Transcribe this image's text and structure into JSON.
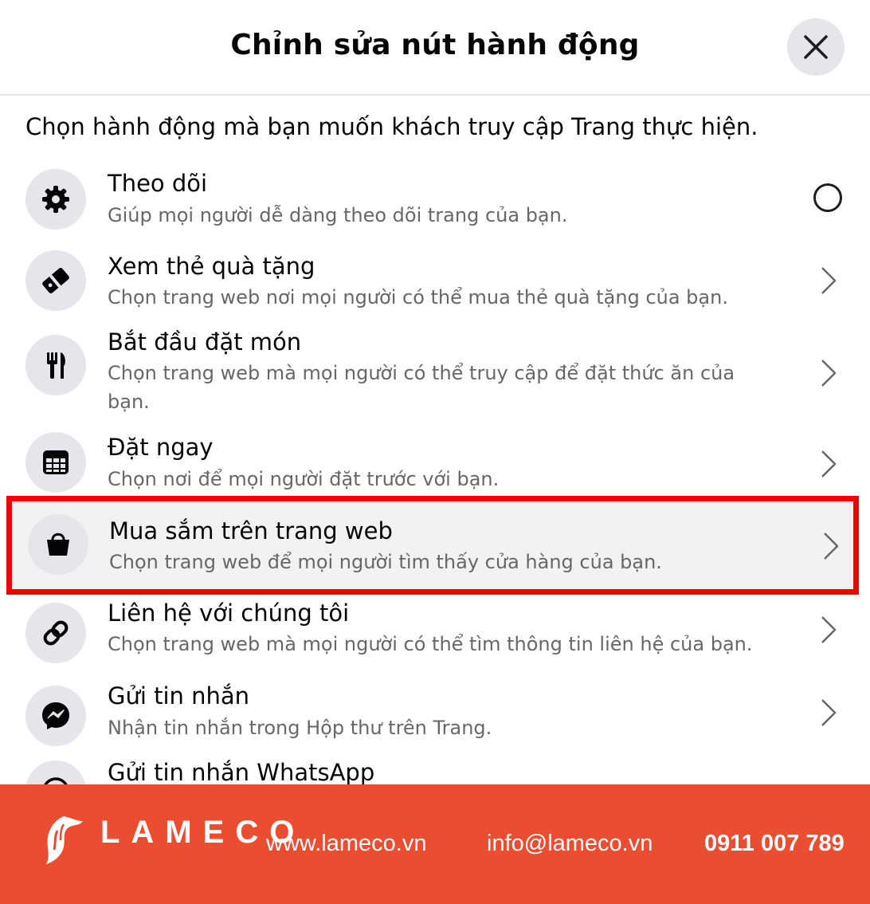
{
  "dialog": {
    "title": "Chỉnh sửa nút hành động",
    "close_icon": "close-icon",
    "intro": "Chọn hành động mà bạn muốn khách truy cập Trang thực hiện."
  },
  "actions": [
    {
      "title": "Theo dõi",
      "description": "Giúp mọi người dễ dàng theo dõi trang của bạn.",
      "icon": "gear-icon",
      "control": "radio-unselected"
    },
    {
      "title": "Xem thẻ quà tặng",
      "description": "Chọn trang web nơi mọi người có thể mua thẻ quà tặng của bạn.",
      "icon": "gift-card-icon",
      "control": "chevron-right"
    },
    {
      "title": "Bắt đầu đặt món",
      "description": "Chọn trang web mà mọi người có thể truy cập để đặt thức ăn của bạn.",
      "icon": "fork-knife-icon",
      "control": "chevron-right"
    },
    {
      "title": "Đặt ngay",
      "description": "Chọn nơi để mọi người đặt trước với bạn.",
      "icon": "calendar-icon",
      "control": "chevron-right"
    },
    {
      "title": "Mua sắm trên trang web",
      "description": "Chọn trang web để mọi người tìm thấy cửa hàng của bạn.",
      "icon": "shopping-bag-icon",
      "control": "chevron-right",
      "highlighted": true
    },
    {
      "title": "Liên hệ với chúng tôi",
      "description": "Chọn trang web mà mọi người có thể tìm thông tin liên hệ của bạn.",
      "icon": "link-icon",
      "control": "chevron-right"
    },
    {
      "title": "Gửi tin nhắn",
      "description": "Nhận tin nhắn trong Hộp thư trên Trang.",
      "icon": "messenger-icon",
      "control": "chevron-right"
    },
    {
      "title": "Gửi tin nhắn WhatsApp",
      "icon": "whatsapp-icon"
    }
  ],
  "footer": {
    "brand": "LAMECO",
    "website": "www.lameco.vn",
    "email": "info@lameco.vn",
    "phone": "0911 007 789",
    "background_color": "#eb4d30"
  },
  "colors": {
    "highlight_frame": "#f40000",
    "icon_background": "#e4e6eb",
    "secondary_text": "#65676b"
  }
}
